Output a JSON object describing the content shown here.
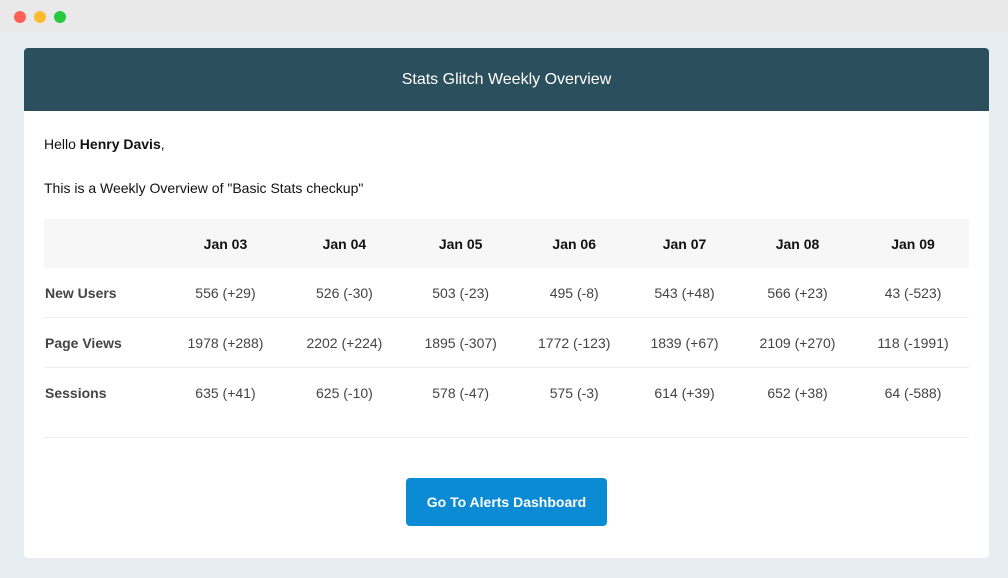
{
  "header": {
    "title": "Stats Glitch Weekly Overview"
  },
  "greeting": {
    "hello": "Hello",
    "name": "Henry Davis",
    "comma": ","
  },
  "intro": "This is a Weekly Overview of \"Basic Stats checkup\"",
  "table": {
    "columns": [
      "Jan 03",
      "Jan 04",
      "Jan 05",
      "Jan 06",
      "Jan 07",
      "Jan 08",
      "Jan 09"
    ],
    "rows": [
      {
        "label": "New Users",
        "cells": [
          "556 (+29)",
          "526 (-30)",
          "503 (-23)",
          "495 (-8)",
          "543 (+48)",
          "566 (+23)",
          "43 (-523)"
        ]
      },
      {
        "label": "Page Views",
        "cells": [
          "1978 (+288)",
          "2202 (+224)",
          "1895 (-307)",
          "1772 (-123)",
          "1839 (+67)",
          "2109 (+270)",
          "118 (-1991)"
        ]
      },
      {
        "label": "Sessions",
        "cells": [
          "635 (+41)",
          "625 (-10)",
          "578 (-47)",
          "575 (-3)",
          "614 (+39)",
          "652 (+38)",
          "64 (-588)"
        ]
      }
    ]
  },
  "cta": {
    "label": "Go To Alerts Dashboard"
  }
}
